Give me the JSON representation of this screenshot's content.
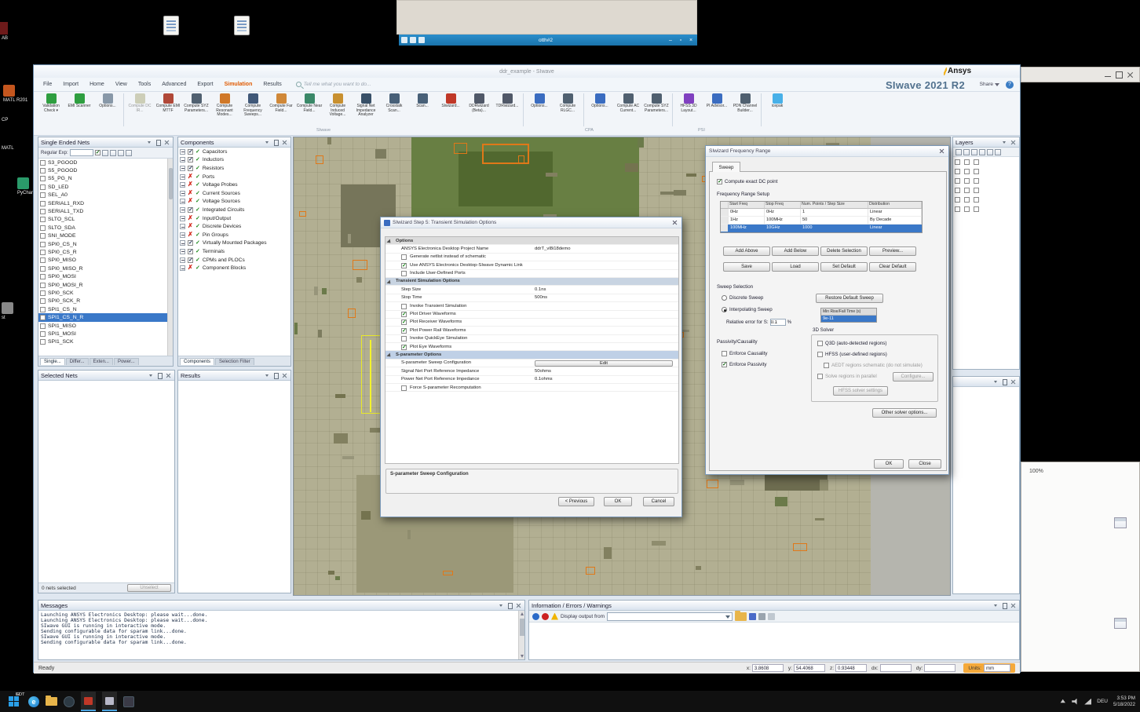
{
  "colors": {
    "selection": "#3a78c8",
    "simulation_tab": "#e05a00",
    "product_text": "#51718e",
    "units_highlight": "#f5a93a",
    "pcb_base": "#b2af92"
  },
  "overlay": {
    "title": "otth#2"
  },
  "desktop": {
    "icons": [
      {
        "label": "AB",
        "color": "#7a1f1f"
      },
      {
        "label": "MATL R201",
        "color": "#c4561e"
      },
      {
        "label": "CP",
        "color": "#5a3a8a"
      },
      {
        "label": "MATL",
        "color": "#c4561e"
      },
      {
        "label": "PyChar Commu",
        "color": "#2a9a6a"
      },
      {
        "label": "st",
        "color": "#888888"
      }
    ],
    "taskbar": {
      "app1": "SI",
      "app2": "EDT",
      "lang": "DEU",
      "time": "3:53 PM",
      "date": "5/18/2022"
    },
    "right_window": {
      "zoom": "100%"
    }
  },
  "window": {
    "title": "ddr_example - SIwave",
    "brand": "Ansys",
    "product": "SIwave 2021 R2",
    "share_label": "Share",
    "help_label": "?",
    "search_placeholder": "Tell me what you want to do...",
    "menus": [
      {
        "label": "File"
      },
      {
        "label": "Import"
      },
      {
        "label": "Home"
      },
      {
        "label": "View"
      },
      {
        "label": "Tools"
      },
      {
        "label": "Advanced"
      },
      {
        "label": "Export"
      },
      {
        "label": "Simulation",
        "active": true
      },
      {
        "label": "Results"
      }
    ],
    "ribbon": {
      "groups": [
        "SIwave",
        "CPA",
        "PSI"
      ],
      "buttons": [
        {
          "label": "Validation Check ▾",
          "color": "#2e9e40"
        },
        {
          "label": "EMI Scanner",
          "color": "#2e9e40"
        },
        {
          "label": "Options...",
          "color": "#8898a8"
        },
        {
          "sep": true
        },
        {
          "label": "Compute DC IR...",
          "color": "#a8a878",
          "dim": true
        },
        {
          "label": "Compute EMI MTTF",
          "color": "#b04838"
        },
        {
          "label": "Compute SYZ Parameters...",
          "color": "#506070"
        },
        {
          "label": "Compute Resonant Modes...",
          "color": "#d07828"
        },
        {
          "label": "Compute Frequency Sweeps...",
          "color": "#405878"
        },
        {
          "label": "Compute Far Field...",
          "color": "#d08838"
        },
        {
          "label": "Compute Near Field...",
          "color": "#3a8868"
        },
        {
          "label": "Compute Induced Voltage...",
          "color": "#c89030"
        },
        {
          "label": "Signal Net Impedance Analyzer",
          "color": "#385068"
        },
        {
          "label": "Crosstalk Scan...",
          "color": "#486078"
        },
        {
          "label": "Scan...",
          "color": "#486078"
        },
        {
          "label": "SIwizard...",
          "color": "#c03828"
        },
        {
          "label": "DDRwizard (Beta)...",
          "color": "#505868"
        },
        {
          "label": "TDRwizard...",
          "color": "#505868"
        },
        {
          "sep": true
        },
        {
          "label": "Options...",
          "color": "#3a6cc0"
        },
        {
          "label": "Compute RLGC...",
          "color": "#506070"
        },
        {
          "sep": true
        },
        {
          "label": "Options...",
          "color": "#3a6cc0"
        },
        {
          "label": "Compute AC Current...",
          "color": "#506070"
        },
        {
          "label": "Compute SYZ Parameters...",
          "color": "#506070"
        },
        {
          "sep": true
        },
        {
          "label": "HFSS 3D Layout...",
          "color": "#8040c0"
        },
        {
          "label": "PI Advisor...",
          "color": "#3a6cc0"
        },
        {
          "label": "PDN Channel Builder...",
          "color": "#506070"
        },
        {
          "sep": true
        },
        {
          "label": "icepak",
          "color": "#48b0e8"
        }
      ]
    }
  },
  "panels": {
    "single_ended_nets": {
      "title": "Single Ended Nets",
      "filter_label": "Regular Exp:",
      "nets": [
        {
          "name": "S3_PGOOD"
        },
        {
          "name": "S5_PGOOD"
        },
        {
          "name": "S5_PG_N"
        },
        {
          "name": "SD_LED"
        },
        {
          "name": "SEL_A0"
        },
        {
          "name": "SERIAL1_RXD"
        },
        {
          "name": "SERIAL1_TXD"
        },
        {
          "name": "SLTO_SCL"
        },
        {
          "name": "SLTO_SDA"
        },
        {
          "name": "SNI_MODE"
        },
        {
          "name": "SPI0_CS_N"
        },
        {
          "name": "SPI0_CS_R"
        },
        {
          "name": "SPI0_MISO"
        },
        {
          "name": "SPI0_MISO_R"
        },
        {
          "name": "SPI0_MOSI"
        },
        {
          "name": "SPI0_MOSI_R"
        },
        {
          "name": "SPI0_SCK"
        },
        {
          "name": "SPI0_SCK_R"
        },
        {
          "name": "SPI1_CS_N"
        },
        {
          "name": "SPI1_CS_N_R",
          "sel": true
        },
        {
          "name": "SPI1_MISO"
        },
        {
          "name": "SPI1_MOSI"
        },
        {
          "name": "SPI1_SCK"
        }
      ],
      "tabs": [
        {
          "label": "Single...",
          "active": true
        },
        {
          "label": "Differ..."
        },
        {
          "label": "Exten..."
        },
        {
          "label": "Power..."
        }
      ]
    },
    "selected_nets": {
      "title": "Selected Nets",
      "status": "0 nets selected",
      "unselect": "Unselect"
    },
    "components": {
      "title": "Components",
      "items": [
        {
          "name": "Capacitors"
        },
        {
          "name": "Inductors"
        },
        {
          "name": "Resistors"
        },
        {
          "name": "Ports",
          "x": true
        },
        {
          "name": "Voltage Probes",
          "x": true
        },
        {
          "name": "Current Sources",
          "x": true
        },
        {
          "name": "Voltage Sources",
          "x": true
        },
        {
          "name": "Integrated Circuits"
        },
        {
          "name": "Input/Output",
          "x": true
        },
        {
          "name": "Discrete Devices",
          "x": true
        },
        {
          "name": "Pin Groups",
          "x": true
        },
        {
          "name": "Virtually Mounted Packages"
        },
        {
          "name": "Terminals"
        },
        {
          "name": "CPMs and PLOCs"
        },
        {
          "name": "Component Blocks",
          "x": true
        }
      ],
      "tabs": [
        {
          "label": "Components",
          "active": true
        },
        {
          "label": "Selection Filter"
        }
      ]
    },
    "results": {
      "title": "Results"
    },
    "layers": {
      "title": "Layers"
    },
    "messages": {
      "title": "Messages",
      "lines": [
        "Launching ANSYS Electronics Desktop: please wait...done.",
        "Launching ANSYS Electronics Desktop: please wait...done.",
        "SIwave GUI is running in interactive mode.",
        "Sending configurable data for sparam link...done.",
        "SIwave GUI is running in interactive mode.",
        "Sending configurable data for sparam link...done."
      ]
    },
    "info": {
      "title": "Information / Errors / Warnings",
      "display_label": "Display output from"
    }
  },
  "dialogs": {
    "transient": {
      "title": "SIwizard Step 5: Transient Simulation Options",
      "rows": [
        {
          "sec": true,
          "label": "Options"
        },
        {
          "label": "ANSYS Electronica Desktop Project Name",
          "value": "ddrT_vl8i18demo"
        },
        {
          "chk": true,
          "label": "Generate netlist instead of schematic"
        },
        {
          "chk": true,
          "on": true,
          "label": "Use ANSYS Electronics Desktop-SIwave Dynamic Link"
        },
        {
          "chk": true,
          "label": "Include User-Defined Ports"
        },
        {
          "sec": true,
          "hl": true,
          "label": "Transient Simulation Options"
        },
        {
          "label": "Step Size",
          "value": "0.1ns"
        },
        {
          "label": "Stop Time",
          "value": "500ns"
        },
        {
          "chk": true,
          "label": "Invoke Transient Simulation"
        },
        {
          "chk": true,
          "on": true,
          "label": "Plot Driver Waveforms"
        },
        {
          "chk": true,
          "on": true,
          "label": "Plot Receiver Waveforms"
        },
        {
          "chk": true,
          "on": true,
          "label": "Plot Power Rail Waveforms"
        },
        {
          "chk": true,
          "label": "Invoke QuickEye Simulation"
        },
        {
          "chk": true,
          "on": true,
          "label": "Plot Eye Waveforms"
        },
        {
          "sec": true,
          "hl2": true,
          "label": "S-parameter Options"
        },
        {
          "label": "S-parameter Sweep Configuration",
          "btn": true,
          "btnlabel": "Edit"
        },
        {
          "label": "Signal Net Port Reference Impedance",
          "value": "50ohms"
        },
        {
          "label": "Power Net Port Reference Impedance",
          "value": "0.1ohms"
        },
        {
          "chk": true,
          "label": "Force S-parameter Recomputation"
        }
      ],
      "group_title": "S-parameter Sweep Configuration",
      "buttons": {
        "previous": "< Previous",
        "ok": "OK",
        "cancel": "Cancel"
      }
    },
    "frequency": {
      "title": "SIwizard Frequency Range",
      "tab": "Sweep",
      "dc_point": "Compute exact DC point",
      "range_setup": "Frequency Range Setup",
      "table": {
        "headers": [
          "",
          "Start Freq",
          "Stop Freq",
          "Num. Points / Step Size",
          "Distribution"
        ],
        "rows": [
          {
            "c0": "0Hz",
            "c1": "0Hz",
            "c2": "1",
            "c3": "Linear"
          },
          {
            "c0": "1Hz",
            "c1": "100MHz",
            "c2": "50",
            "c3": "By Decade"
          },
          {
            "c0": "100MHz",
            "c1": "10GHz",
            "c2": "1000",
            "c3": "Linear",
            "sel": true
          }
        ]
      },
      "row_buttons": [
        "Add Above",
        "Add Below",
        "Delete Selection",
        "Preview..."
      ],
      "file_buttons": [
        "Save",
        "Load",
        "Set Default",
        "Clear Default"
      ],
      "sweep_selection": "Sweep Selection",
      "discrete": "Discrete Sweep",
      "interpolating": "Interpolating Sweep",
      "rel_error_label": "Relative error for S:",
      "rel_error_value": "0.1",
      "rel_error_unit": "%",
      "restore_default": "Restore Default Sweep",
      "min_rise_label": "Min Rise/Fall Time (s)",
      "min_rise_value": "9e-11",
      "solver_label": "3D Solver",
      "q3d": "Q3D (auto-detected regions)",
      "hfss": "HFSS (user-defined regions)",
      "aedt": "AEDT regions schematic (do not simulate)",
      "parallel": "Solve regions in parallel",
      "configure": "Configure...",
      "hfss_settings": "HFSS solver settings",
      "passivity_label": "Passivity/Causality",
      "causality": "Enforce Causality",
      "passivity": "Enforce Passivity",
      "other_options": "Other solver options...",
      "ok": "OK",
      "close": "Close"
    }
  },
  "statusbar": {
    "ready": "Ready",
    "coords": [
      {
        "label": "x:",
        "value": "3.8608"
      },
      {
        "label": "y:",
        "value": "54.4068"
      },
      {
        "label": "z:",
        "value": "0.93448"
      },
      {
        "label": "dx:",
        "value": ""
      },
      {
        "label": "dy:",
        "value": ""
      }
    ],
    "units_label": "Units:",
    "units_value": "mm"
  }
}
